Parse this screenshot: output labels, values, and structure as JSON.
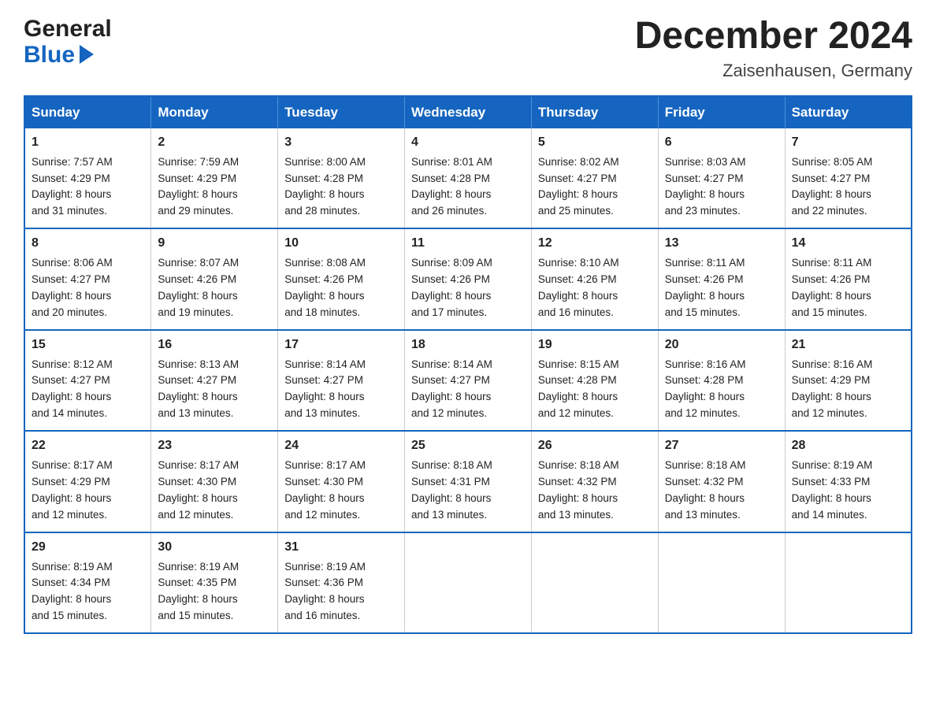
{
  "header": {
    "logo_general": "General",
    "logo_blue": "Blue",
    "month_title": "December 2024",
    "location": "Zaisenhausen, Germany"
  },
  "days_of_week": [
    "Sunday",
    "Monday",
    "Tuesday",
    "Wednesday",
    "Thursday",
    "Friday",
    "Saturday"
  ],
  "weeks": [
    [
      {
        "day": "1",
        "sunrise": "Sunrise: 7:57 AM",
        "sunset": "Sunset: 4:29 PM",
        "daylight": "Daylight: 8 hours",
        "daylight2": "and 31 minutes."
      },
      {
        "day": "2",
        "sunrise": "Sunrise: 7:59 AM",
        "sunset": "Sunset: 4:29 PM",
        "daylight": "Daylight: 8 hours",
        "daylight2": "and 29 minutes."
      },
      {
        "day": "3",
        "sunrise": "Sunrise: 8:00 AM",
        "sunset": "Sunset: 4:28 PM",
        "daylight": "Daylight: 8 hours",
        "daylight2": "and 28 minutes."
      },
      {
        "day": "4",
        "sunrise": "Sunrise: 8:01 AM",
        "sunset": "Sunset: 4:28 PM",
        "daylight": "Daylight: 8 hours",
        "daylight2": "and 26 minutes."
      },
      {
        "day": "5",
        "sunrise": "Sunrise: 8:02 AM",
        "sunset": "Sunset: 4:27 PM",
        "daylight": "Daylight: 8 hours",
        "daylight2": "and 25 minutes."
      },
      {
        "day": "6",
        "sunrise": "Sunrise: 8:03 AM",
        "sunset": "Sunset: 4:27 PM",
        "daylight": "Daylight: 8 hours",
        "daylight2": "and 23 minutes."
      },
      {
        "day": "7",
        "sunrise": "Sunrise: 8:05 AM",
        "sunset": "Sunset: 4:27 PM",
        "daylight": "Daylight: 8 hours",
        "daylight2": "and 22 minutes."
      }
    ],
    [
      {
        "day": "8",
        "sunrise": "Sunrise: 8:06 AM",
        "sunset": "Sunset: 4:27 PM",
        "daylight": "Daylight: 8 hours",
        "daylight2": "and 20 minutes."
      },
      {
        "day": "9",
        "sunrise": "Sunrise: 8:07 AM",
        "sunset": "Sunset: 4:26 PM",
        "daylight": "Daylight: 8 hours",
        "daylight2": "and 19 minutes."
      },
      {
        "day": "10",
        "sunrise": "Sunrise: 8:08 AM",
        "sunset": "Sunset: 4:26 PM",
        "daylight": "Daylight: 8 hours",
        "daylight2": "and 18 minutes."
      },
      {
        "day": "11",
        "sunrise": "Sunrise: 8:09 AM",
        "sunset": "Sunset: 4:26 PM",
        "daylight": "Daylight: 8 hours",
        "daylight2": "and 17 minutes."
      },
      {
        "day": "12",
        "sunrise": "Sunrise: 8:10 AM",
        "sunset": "Sunset: 4:26 PM",
        "daylight": "Daylight: 8 hours",
        "daylight2": "and 16 minutes."
      },
      {
        "day": "13",
        "sunrise": "Sunrise: 8:11 AM",
        "sunset": "Sunset: 4:26 PM",
        "daylight": "Daylight: 8 hours",
        "daylight2": "and 15 minutes."
      },
      {
        "day": "14",
        "sunrise": "Sunrise: 8:11 AM",
        "sunset": "Sunset: 4:26 PM",
        "daylight": "Daylight: 8 hours",
        "daylight2": "and 15 minutes."
      }
    ],
    [
      {
        "day": "15",
        "sunrise": "Sunrise: 8:12 AM",
        "sunset": "Sunset: 4:27 PM",
        "daylight": "Daylight: 8 hours",
        "daylight2": "and 14 minutes."
      },
      {
        "day": "16",
        "sunrise": "Sunrise: 8:13 AM",
        "sunset": "Sunset: 4:27 PM",
        "daylight": "Daylight: 8 hours",
        "daylight2": "and 13 minutes."
      },
      {
        "day": "17",
        "sunrise": "Sunrise: 8:14 AM",
        "sunset": "Sunset: 4:27 PM",
        "daylight": "Daylight: 8 hours",
        "daylight2": "and 13 minutes."
      },
      {
        "day": "18",
        "sunrise": "Sunrise: 8:14 AM",
        "sunset": "Sunset: 4:27 PM",
        "daylight": "Daylight: 8 hours",
        "daylight2": "and 12 minutes."
      },
      {
        "day": "19",
        "sunrise": "Sunrise: 8:15 AM",
        "sunset": "Sunset: 4:28 PM",
        "daylight": "Daylight: 8 hours",
        "daylight2": "and 12 minutes."
      },
      {
        "day": "20",
        "sunrise": "Sunrise: 8:16 AM",
        "sunset": "Sunset: 4:28 PM",
        "daylight": "Daylight: 8 hours",
        "daylight2": "and 12 minutes."
      },
      {
        "day": "21",
        "sunrise": "Sunrise: 8:16 AM",
        "sunset": "Sunset: 4:29 PM",
        "daylight": "Daylight: 8 hours",
        "daylight2": "and 12 minutes."
      }
    ],
    [
      {
        "day": "22",
        "sunrise": "Sunrise: 8:17 AM",
        "sunset": "Sunset: 4:29 PM",
        "daylight": "Daylight: 8 hours",
        "daylight2": "and 12 minutes."
      },
      {
        "day": "23",
        "sunrise": "Sunrise: 8:17 AM",
        "sunset": "Sunset: 4:30 PM",
        "daylight": "Daylight: 8 hours",
        "daylight2": "and 12 minutes."
      },
      {
        "day": "24",
        "sunrise": "Sunrise: 8:17 AM",
        "sunset": "Sunset: 4:30 PM",
        "daylight": "Daylight: 8 hours",
        "daylight2": "and 12 minutes."
      },
      {
        "day": "25",
        "sunrise": "Sunrise: 8:18 AM",
        "sunset": "Sunset: 4:31 PM",
        "daylight": "Daylight: 8 hours",
        "daylight2": "and 13 minutes."
      },
      {
        "day": "26",
        "sunrise": "Sunrise: 8:18 AM",
        "sunset": "Sunset: 4:32 PM",
        "daylight": "Daylight: 8 hours",
        "daylight2": "and 13 minutes."
      },
      {
        "day": "27",
        "sunrise": "Sunrise: 8:18 AM",
        "sunset": "Sunset: 4:32 PM",
        "daylight": "Daylight: 8 hours",
        "daylight2": "and 13 minutes."
      },
      {
        "day": "28",
        "sunrise": "Sunrise: 8:19 AM",
        "sunset": "Sunset: 4:33 PM",
        "daylight": "Daylight: 8 hours",
        "daylight2": "and 14 minutes."
      }
    ],
    [
      {
        "day": "29",
        "sunrise": "Sunrise: 8:19 AM",
        "sunset": "Sunset: 4:34 PM",
        "daylight": "Daylight: 8 hours",
        "daylight2": "and 15 minutes."
      },
      {
        "day": "30",
        "sunrise": "Sunrise: 8:19 AM",
        "sunset": "Sunset: 4:35 PM",
        "daylight": "Daylight: 8 hours",
        "daylight2": "and 15 minutes."
      },
      {
        "day": "31",
        "sunrise": "Sunrise: 8:19 AM",
        "sunset": "Sunset: 4:36 PM",
        "daylight": "Daylight: 8 hours",
        "daylight2": "and 16 minutes."
      },
      {
        "day": "",
        "sunrise": "",
        "sunset": "",
        "daylight": "",
        "daylight2": ""
      },
      {
        "day": "",
        "sunrise": "",
        "sunset": "",
        "daylight": "",
        "daylight2": ""
      },
      {
        "day": "",
        "sunrise": "",
        "sunset": "",
        "daylight": "",
        "daylight2": ""
      },
      {
        "day": "",
        "sunrise": "",
        "sunset": "",
        "daylight": "",
        "daylight2": ""
      }
    ]
  ]
}
